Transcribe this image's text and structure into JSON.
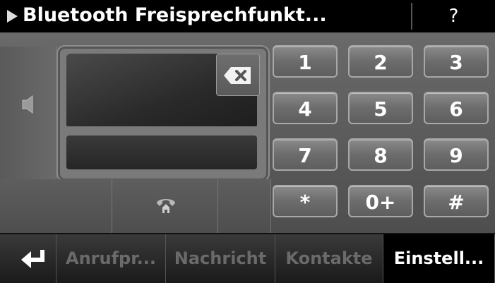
{
  "header": {
    "title": "Bluetooth Freisprechfunkt...",
    "help_label": "?"
  },
  "icons": {
    "title": "play-triangle-icon",
    "speaker": "speaker-icon",
    "backspace": "backspace-icon",
    "phone": "phone-home-icon",
    "back": "return-arrow-icon"
  },
  "keypad": {
    "keys": [
      "1",
      "2",
      "3",
      "4",
      "5",
      "6",
      "7",
      "8",
      "9",
      "*",
      "0+",
      "#"
    ]
  },
  "tabs": {
    "anrufprotokoll": "Anrufpr...",
    "nachricht": "Nachricht",
    "kontakte": "Kontakte",
    "einstellungen": "Einstell..."
  },
  "colors": {
    "key_text": "#ffffff",
    "disabled_text": "#6a6a6a",
    "accent": "#000000"
  }
}
